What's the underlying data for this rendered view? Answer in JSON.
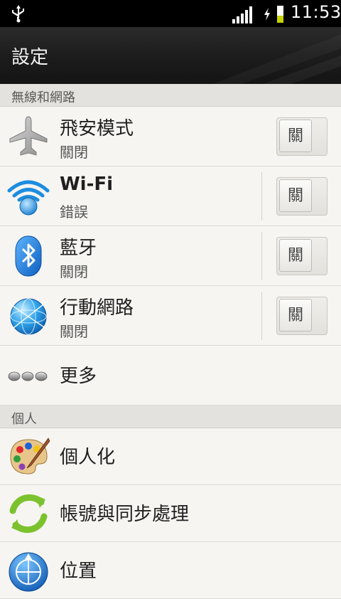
{
  "status_bar": {
    "time": "11:53",
    "icons": [
      "usb-icon",
      "signal-icon",
      "charging-icon",
      "battery-icon"
    ],
    "battery_color": "#c8d400"
  },
  "header": {
    "title": "設定"
  },
  "sections": [
    {
      "label": "無線和網路",
      "items": [
        {
          "title": "飛安模式",
          "subtitle": "關閉",
          "toggle": "關",
          "icon": "airplane-icon"
        },
        {
          "title": "Wi-Fi",
          "subtitle": "錯誤",
          "toggle": "關",
          "icon": "wifi-icon"
        },
        {
          "title": "藍牙",
          "subtitle": "關閉",
          "toggle": "關",
          "icon": "bluetooth-icon"
        },
        {
          "title": "行動網路",
          "subtitle": "關閉",
          "toggle": "關",
          "icon": "mobile-network-icon"
        },
        {
          "title": "更多",
          "icon": "more-icon"
        }
      ]
    },
    {
      "label": "個人",
      "items": [
        {
          "title": "個人化",
          "icon": "palette-icon"
        },
        {
          "title": "帳號與同步處理",
          "icon": "sync-icon"
        },
        {
          "title": "位置",
          "icon": "location-globe-icon"
        }
      ]
    }
  ]
}
